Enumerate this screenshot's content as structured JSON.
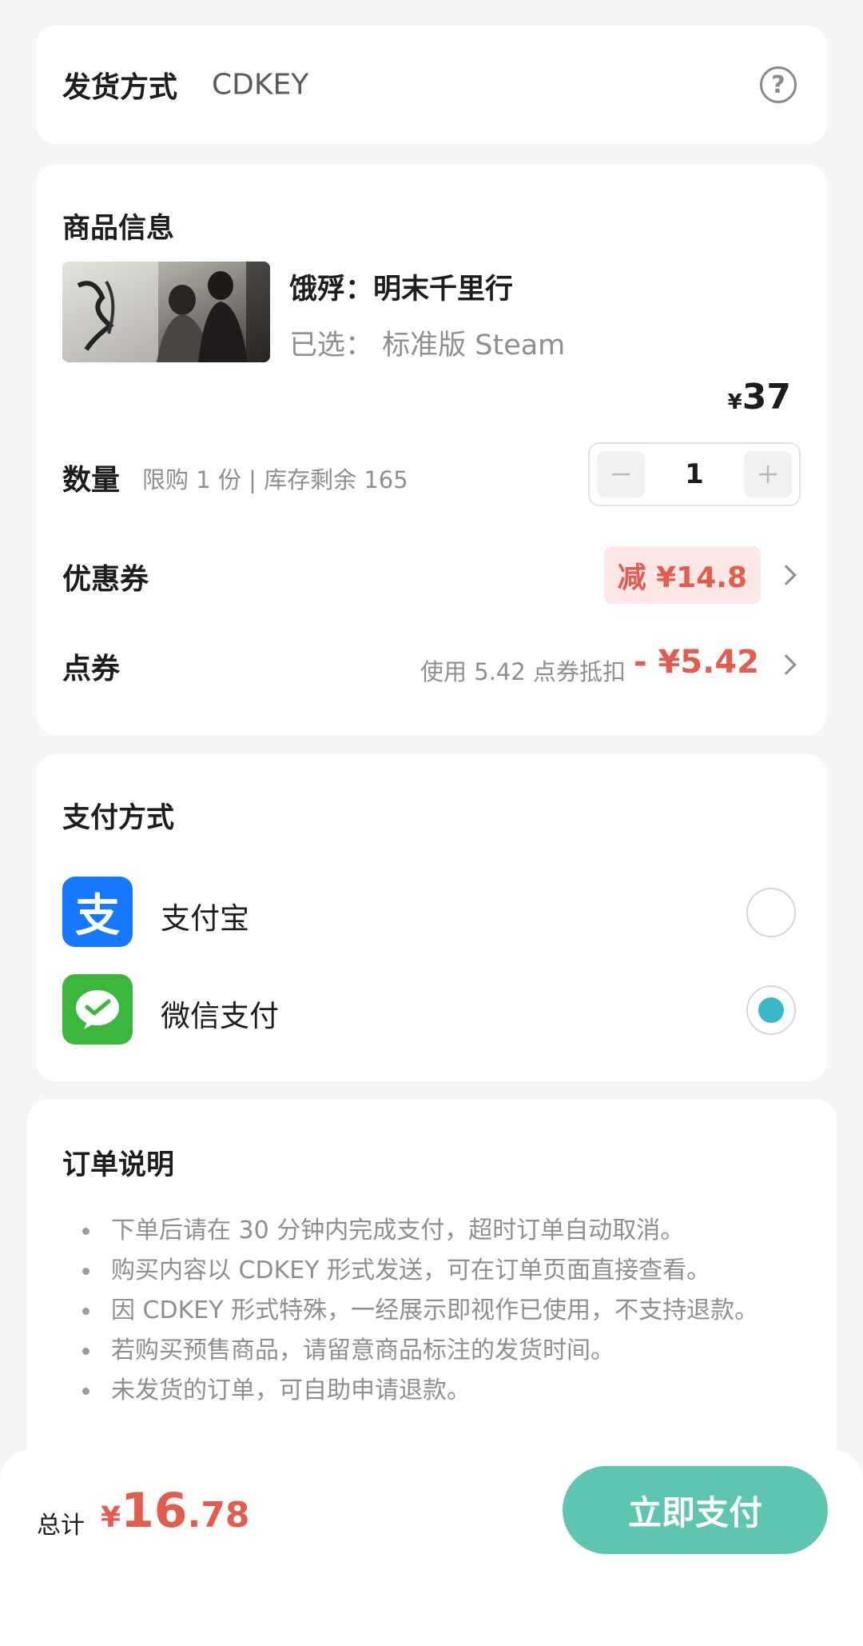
{
  "delivery": {
    "label": "发货方式",
    "value": "CDKEY",
    "help_icon": "question-circle-icon"
  },
  "product": {
    "title": "商品信息",
    "name": "饿殍：明末千里行",
    "variant": "已选：  标准版 Steam",
    "price_currency": "¥",
    "price": "37",
    "quantity_label": "数量",
    "quantity_note": "限购 1 份 | 库存剩余 165",
    "quantity": "1",
    "coupon_label": "优惠券",
    "coupon_value": "减 ¥14.8",
    "points_label": "点券",
    "points_note": "使用 5.42 点券抵扣",
    "points_value": "- ¥5.42"
  },
  "payment": {
    "title": "支付方式",
    "methods": [
      {
        "name": "支付宝",
        "icon": "alipay-icon",
        "selected": false
      },
      {
        "name": "微信支付",
        "icon": "wechat-pay-icon",
        "selected": true
      }
    ]
  },
  "notes": {
    "title": "订单说明",
    "items": [
      "下单后请在 30 分钟内完成支付，超时订单自动取消。",
      "购买内容以 CDKEY 形式发送，可在订单页面直接查看。",
      "因 CDKEY 形式特殊，一经展示即视作已使用，不支持退款。",
      "若购买预售商品，请留意商品标注的发货时间。",
      "未发货的订单，可自助申请退款。"
    ]
  },
  "footer": {
    "total_label": "总计",
    "total_currency": "¥",
    "total_int": "16",
    "total_dec": ".78",
    "pay_button": "立即支付"
  },
  "colors": {
    "accent": "#5ec5b1",
    "price_red": "#e25d4f",
    "alipay": "#1677ff",
    "wechat": "#3cb73d",
    "radio_selected": "#3ab8c9"
  }
}
